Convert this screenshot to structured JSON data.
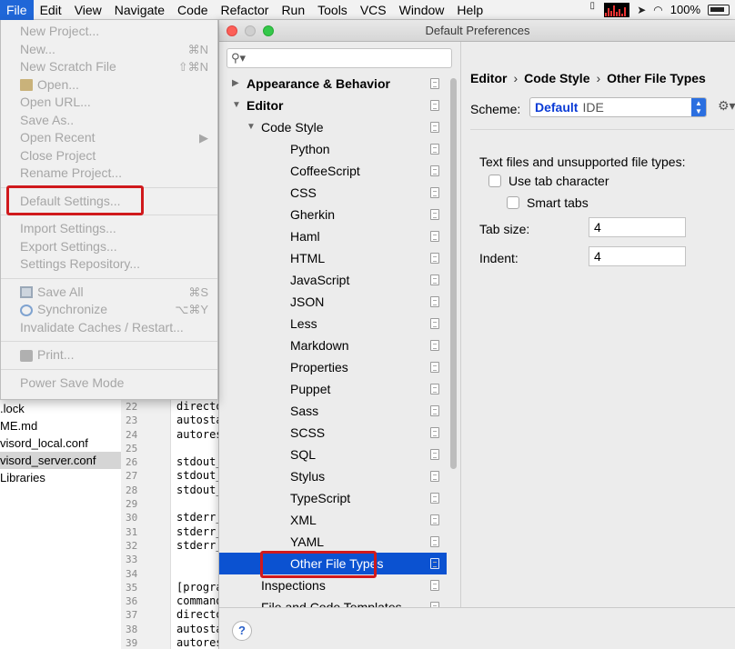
{
  "menubar": {
    "items": [
      "File",
      "Edit",
      "View",
      "Navigate",
      "Code",
      "Refactor",
      "Run",
      "Tools",
      "VCS",
      "Window",
      "Help"
    ],
    "active_index": 0,
    "battery_text": "100%",
    "accent_color": "#1f67d8"
  },
  "file_menu": {
    "groups": [
      [
        {
          "label": "New Project...",
          "shortcut": ""
        },
        {
          "label": "New...",
          "shortcut": "⌘N"
        },
        {
          "label": "New Scratch File",
          "shortcut": "⇧⌘N"
        },
        {
          "label": "Open...",
          "shortcut": "",
          "icon": "folder-icon"
        },
        {
          "label": "Open URL...",
          "shortcut": ""
        },
        {
          "label": "Save As..",
          "shortcut": ""
        },
        {
          "label": "Open Recent",
          "shortcut": "▶"
        },
        {
          "label": "Close Project",
          "shortcut": ""
        },
        {
          "label": "Rename Project...",
          "shortcut": ""
        }
      ],
      [
        {
          "label": "Default Settings...",
          "shortcut": ""
        }
      ],
      [
        {
          "label": "Import Settings...",
          "shortcut": ""
        },
        {
          "label": "Export Settings...",
          "shortcut": ""
        },
        {
          "label": "Settings Repository...",
          "shortcut": ""
        }
      ],
      [
        {
          "label": "Save All",
          "shortcut": "⌘S",
          "icon": "save-icon"
        },
        {
          "label": "Synchronize",
          "shortcut": "⌥⌘Y",
          "icon": "sync-icon"
        },
        {
          "label": "Invalidate Caches / Restart...",
          "shortcut": ""
        }
      ],
      [
        {
          "label": "Print...",
          "shortcut": "",
          "icon": "print-icon"
        }
      ],
      [
        {
          "label": "Power Save Mode",
          "shortcut": ""
        }
      ]
    ]
  },
  "project_tree": {
    "files": [
      ".lock",
      "ME.md",
      "visord_local.conf",
      "visord_server.conf",
      "Libraries"
    ],
    "selected_index": 3
  },
  "editor": {
    "line_numbers": [
      "22",
      "23",
      "24",
      "25",
      "26",
      "27",
      "28",
      "29",
      "30",
      "31",
      "32",
      "33",
      "34",
      "35",
      "36",
      "37",
      "38",
      "39"
    ],
    "code_lines": [
      "directo",
      "autosta",
      "autores",
      "",
      "stdout_",
      "stdout_",
      "stdout_",
      "",
      "stderr_",
      "stderr_",
      "stderr_",
      "",
      "",
      "[progra",
      "command",
      "directo",
      "autosta",
      "autores"
    ]
  },
  "dialog": {
    "title": "Default Preferences",
    "search_placeholder": "",
    "tree": [
      {
        "label": "Appearance & Behavior",
        "level": 0,
        "arrow": "right",
        "bold": true
      },
      {
        "label": "Editor",
        "level": 0,
        "arrow": "down",
        "bold": true
      },
      {
        "label": "Code Style",
        "level": 1,
        "arrow": "down"
      },
      {
        "label": "Python",
        "level": 2
      },
      {
        "label": "CoffeeScript",
        "level": 2
      },
      {
        "label": "CSS",
        "level": 2
      },
      {
        "label": "Gherkin",
        "level": 2
      },
      {
        "label": "Haml",
        "level": 2
      },
      {
        "label": "HTML",
        "level": 2
      },
      {
        "label": "JavaScript",
        "level": 2
      },
      {
        "label": "JSON",
        "level": 2
      },
      {
        "label": "Less",
        "level": 2
      },
      {
        "label": "Markdown",
        "level": 2
      },
      {
        "label": "Properties",
        "level": 2
      },
      {
        "label": "Puppet",
        "level": 2
      },
      {
        "label": "Sass",
        "level": 2
      },
      {
        "label": "SCSS",
        "level": 2
      },
      {
        "label": "SQL",
        "level": 2
      },
      {
        "label": "Stylus",
        "level": 2
      },
      {
        "label": "TypeScript",
        "level": 2
      },
      {
        "label": "XML",
        "level": 2
      },
      {
        "label": "YAML",
        "level": 2
      },
      {
        "label": "Other File Types",
        "level": 2,
        "selected": true
      },
      {
        "label": "Inspections",
        "level": 1
      },
      {
        "label": "File and Code Templates",
        "level": 1
      }
    ],
    "selection_color": "#0b52d1",
    "breadcrumb": [
      "Editor",
      "Code Style",
      "Other File Types"
    ],
    "breadcrumb_sep": "›",
    "scheme_label": "Scheme:",
    "scheme_value": "Default",
    "scheme_sub": "IDE",
    "text_files_label": "Text files and unsupported file types:",
    "use_tab_label": "Use tab character",
    "smart_tabs_label": "Smart tabs",
    "tab_size_label": "Tab size:",
    "tab_size_value": "4",
    "indent_label": "Indent:",
    "indent_value": "4",
    "help_label": "?"
  },
  "highlight_color": "#d0191c"
}
